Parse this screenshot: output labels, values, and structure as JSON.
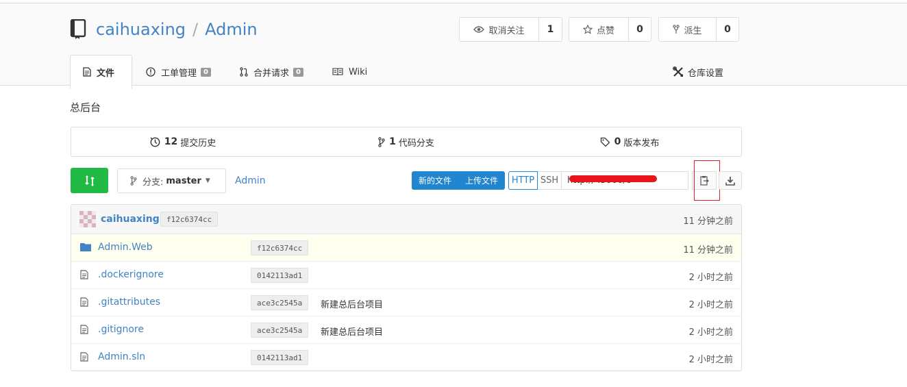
{
  "repo": {
    "owner": "caihuaxing",
    "separator": "/",
    "name": "Admin"
  },
  "actions": {
    "watch": {
      "label": "取消关注",
      "count": "1"
    },
    "star": {
      "label": "点赞",
      "count": "0"
    },
    "fork": {
      "label": "派生",
      "count": "0"
    }
  },
  "tabs": [
    {
      "label": "文件"
    },
    {
      "label": "工单管理",
      "badge": "0"
    },
    {
      "label": "合并请求",
      "badge": "0"
    },
    {
      "label": "Wiki"
    }
  ],
  "settings_label": "仓库设置",
  "description": "总后台",
  "stats": {
    "commits": {
      "count": "12",
      "label": "提交历史"
    },
    "branches": {
      "count": "1",
      "label": "代码分支"
    },
    "releases": {
      "count": "0",
      "label": "版本发布"
    }
  },
  "branch": {
    "prefix": "分支:",
    "name": "master"
  },
  "breadcrumb": "Admin",
  "file_buttons": {
    "new_file": "新的文件",
    "upload": "上传文件"
  },
  "clone": {
    "http": "HTTP",
    "ssh": "SSH",
    "url": "http://              :3000/c"
  },
  "latest_commit": {
    "author": "caihuaxing",
    "sha": "f12c6374cc",
    "time": "11 分钟之前"
  },
  "files": [
    {
      "name": "Admin.Web",
      "type": "folder",
      "sha": "f12c6374cc",
      "message": "",
      "time": "11 分钟之前"
    },
    {
      "name": ".dockerignore",
      "type": "file",
      "sha": "0142113ad1",
      "message": "",
      "time": "2 小时之前"
    },
    {
      "name": ".gitattributes",
      "type": "file",
      "sha": "ace3c2545a",
      "message": "新建总后台项目",
      "time": "2 小时之前"
    },
    {
      "name": ".gitignore",
      "type": "file",
      "sha": "ace3c2545a",
      "message": "新建总后台项目",
      "time": "2 小时之前"
    },
    {
      "name": "Admin.sln",
      "type": "file",
      "sha": "0142113ad1",
      "message": "",
      "time": "2 小时之前"
    }
  ],
  "colors": {
    "link": "#4183c4",
    "primary": "#2185d0",
    "success": "#21ba45",
    "highlight_box": "#e31b23",
    "redaction": "#e8141b"
  }
}
